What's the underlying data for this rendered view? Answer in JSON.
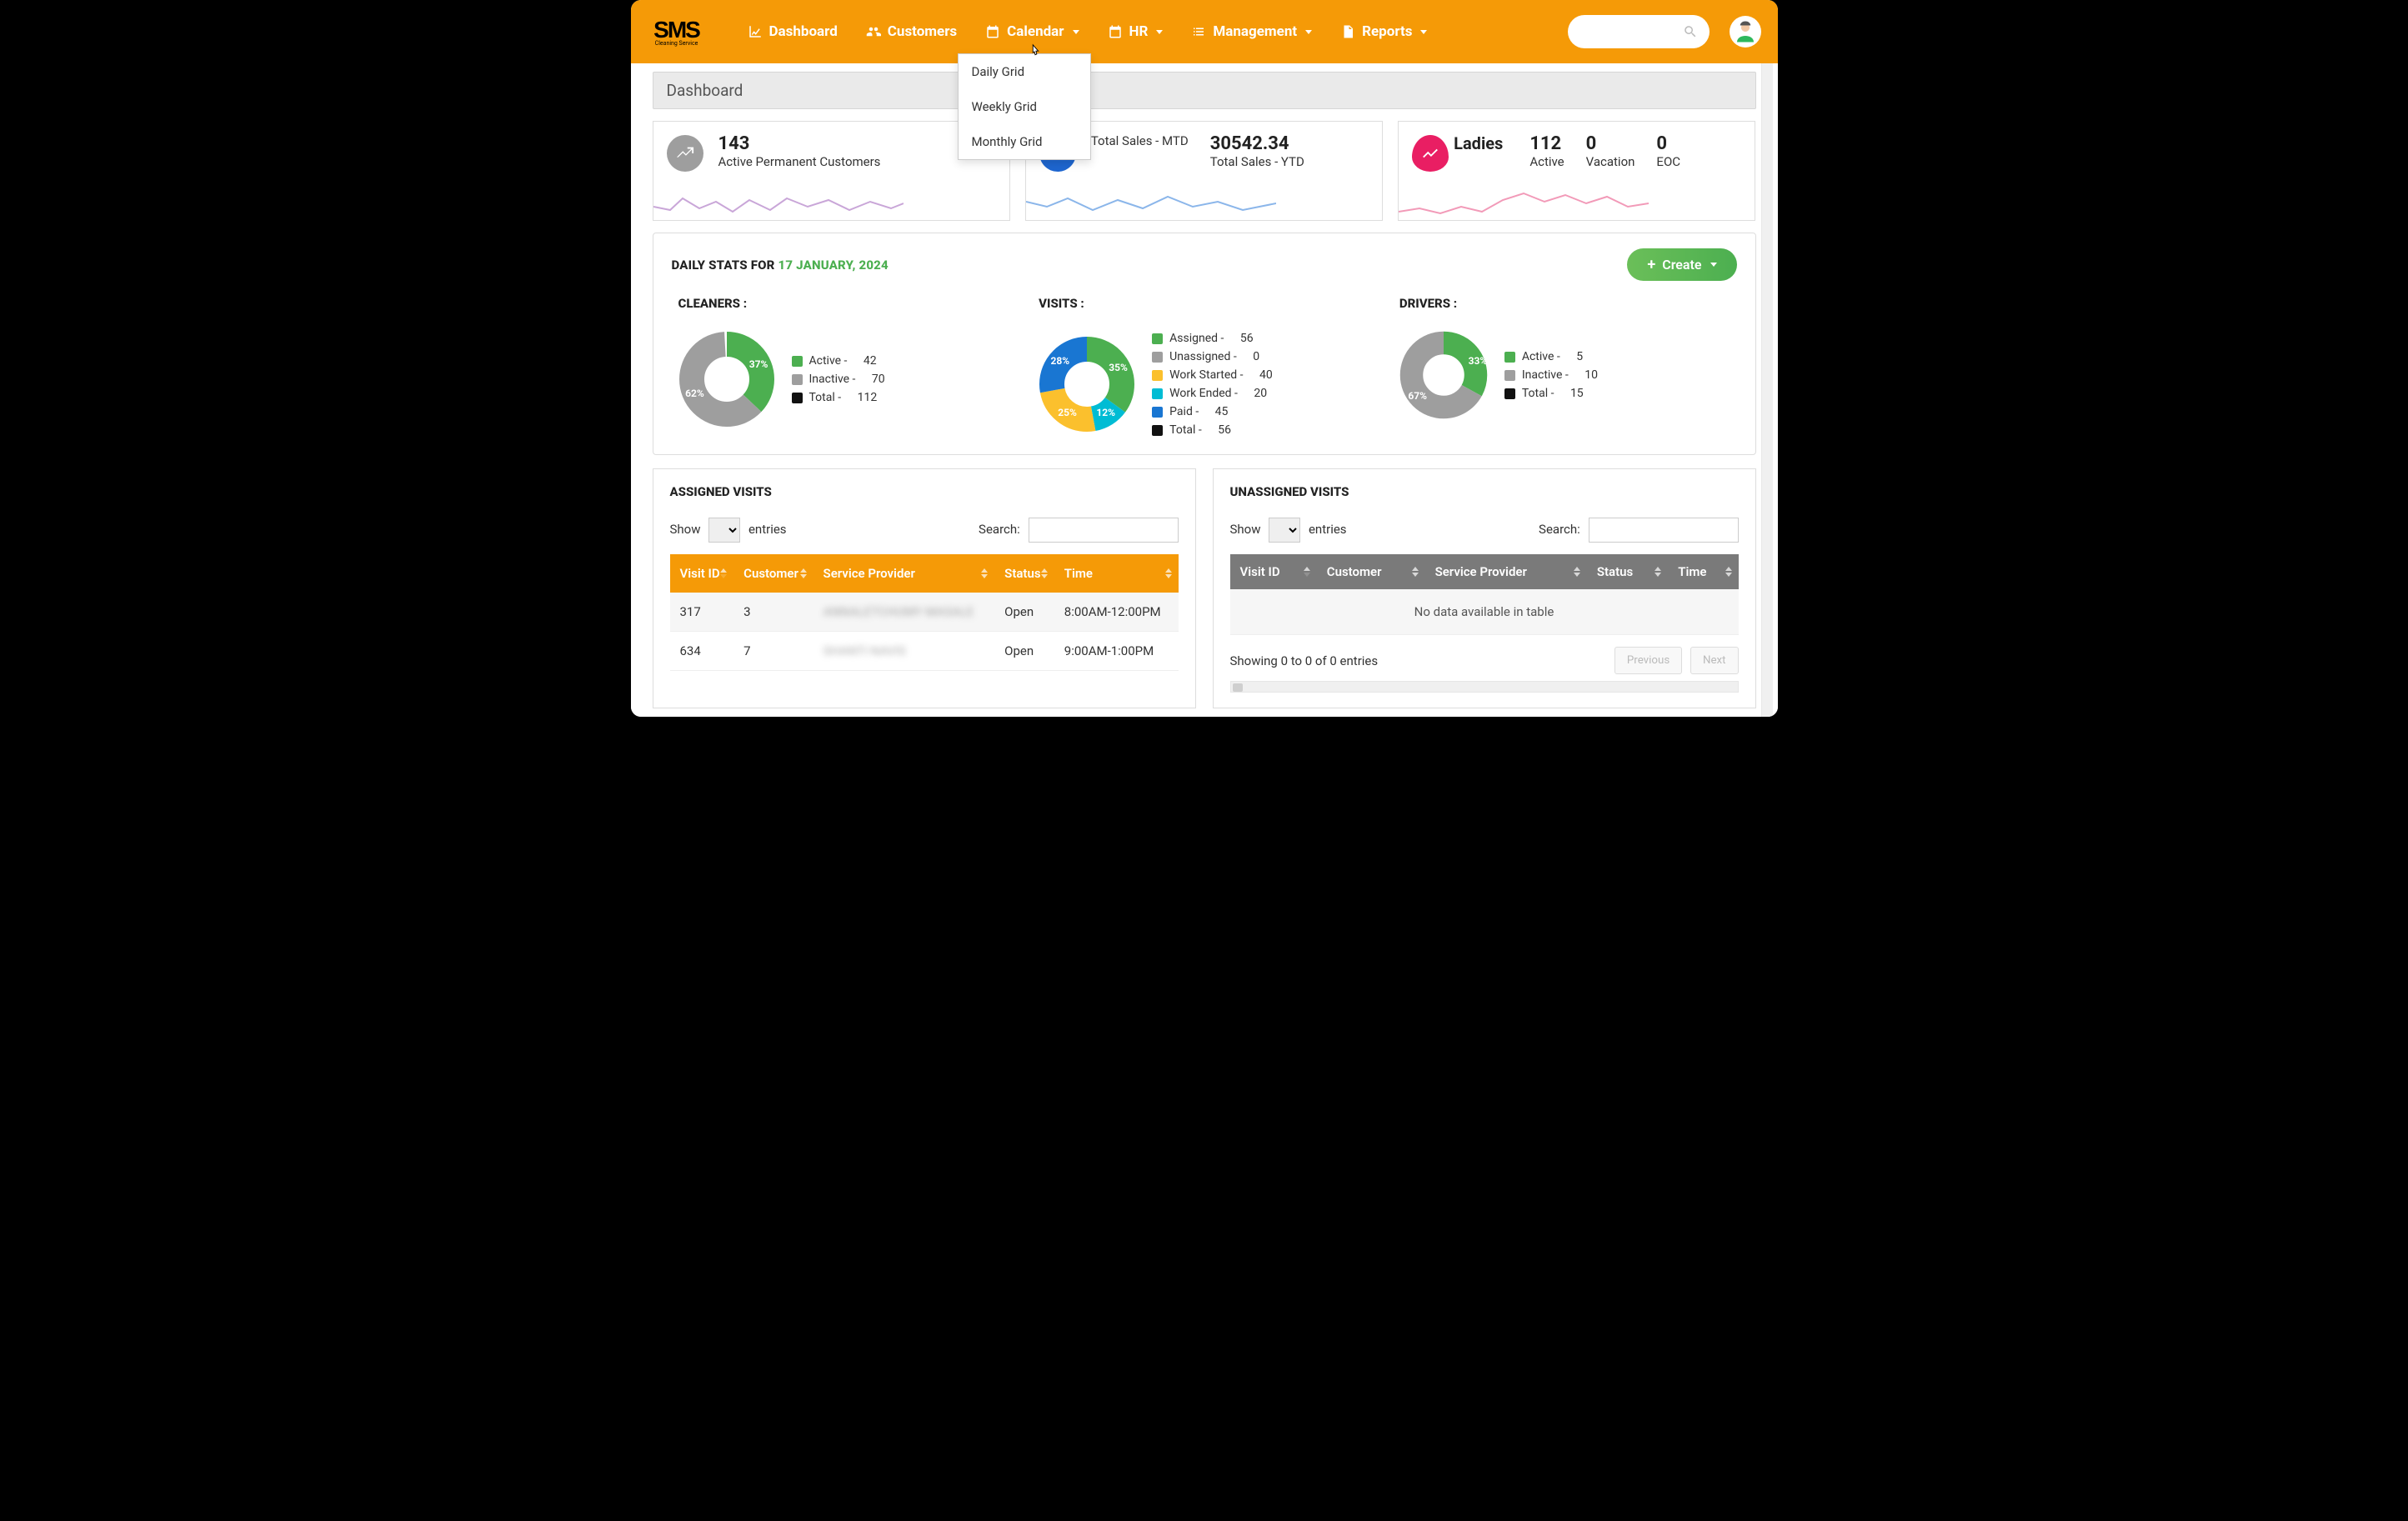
{
  "brand": {
    "name": "SMS",
    "sub": "Cleaning Service"
  },
  "nav": {
    "dashboard": "Dashboard",
    "customers": "Customers",
    "calendar": "Calendar",
    "hr": "HR",
    "management": "Management",
    "reports": "Reports"
  },
  "calendar_dropdown": [
    "Daily Grid",
    "Weekly Grid",
    "Monthly Grid"
  ],
  "page_title": "Dashboard",
  "cards": {
    "customers": {
      "value": "143",
      "label": "Active Permanent Customers",
      "color": "#9e9e9e"
    },
    "sales": {
      "mtd_value": "",
      "mtd_label": "Total Sales - MTD",
      "ytd_value": "30542.34",
      "ytd_label": "Total Sales - YTD",
      "color": "#1e66d0"
    },
    "ladies": {
      "title": "Ladies",
      "active_value": "112",
      "active_label": "Active",
      "vacation_value": "0",
      "vacation_label": "Vacation",
      "eoc_value": "0",
      "eoc_label": "EOC",
      "color": "#e91e63"
    }
  },
  "daily": {
    "title_prefix": "DAILY STATS FOR ",
    "date": "17 JANUARY, 2024",
    "create": "Create"
  },
  "cleaners": {
    "heading": "CLEANERS :",
    "legend": [
      {
        "label": "Active",
        "value": 42,
        "color": "#4CAF50"
      },
      {
        "label": "Inactive",
        "value": 70,
        "color": "#9e9e9e"
      },
      {
        "label": "Total",
        "value": 112,
        "color": "#111"
      }
    ],
    "slices": [
      {
        "pct": 37,
        "color": "#4CAF50"
      },
      {
        "pct": 62,
        "color": "#9e9e9e"
      }
    ]
  },
  "visits": {
    "heading": "VISITS :",
    "legend": [
      {
        "label": "Assigned",
        "value": 56,
        "color": "#4CAF50"
      },
      {
        "label": "Unassigned",
        "value": 0,
        "color": "#9e9e9e"
      },
      {
        "label": "Work Started",
        "value": 40,
        "color": "#fbc02d"
      },
      {
        "label": "Work Ended",
        "value": 20,
        "color": "#00bcd4"
      },
      {
        "label": "Paid",
        "value": 45,
        "color": "#1976d2"
      },
      {
        "label": "Total",
        "value": 56,
        "color": "#111"
      }
    ],
    "slices": [
      {
        "pct": 35,
        "color": "#4CAF50"
      },
      {
        "pct": 12,
        "color": "#00bcd4"
      },
      {
        "pct": 25,
        "color": "#fbc02d"
      },
      {
        "pct": 28,
        "color": "#1976d2"
      }
    ]
  },
  "drivers": {
    "heading": "DRIVERS :",
    "legend": [
      {
        "label": "Active",
        "value": 5,
        "color": "#4CAF50"
      },
      {
        "label": "Inactive",
        "value": 10,
        "color": "#9e9e9e"
      },
      {
        "label": "Total",
        "value": 15,
        "color": "#111"
      }
    ],
    "slices": [
      {
        "pct": 33,
        "color": "#4CAF50"
      },
      {
        "pct": 67,
        "color": "#9e9e9e"
      }
    ]
  },
  "assigned": {
    "heading": "ASSIGNED VISITS",
    "show": "Show",
    "entries": "entries",
    "search": "Search:",
    "cols": [
      "Visit ID",
      "Customer",
      "Service Provider",
      "Status",
      "Time"
    ],
    "rows": [
      {
        "id": "317",
        "customer": "3",
        "provider": "ANNALETCHUMY MASALE",
        "status": "Open",
        "time": "8:00AM-12:00PM"
      },
      {
        "id": "634",
        "customer": "7",
        "provider": "SHANTI NAVIS",
        "status": "Open",
        "time": "9:00AM-1:00PM"
      }
    ]
  },
  "unassigned": {
    "heading": "UNASSIGNED VISITS",
    "show": "Show",
    "entries": "entries",
    "search": "Search:",
    "cols": [
      "Visit ID",
      "Customer",
      "Service Provider",
      "Status",
      "Time"
    ],
    "empty": "No data available in table",
    "info": "Showing 0 to 0 of 0 entries",
    "prev": "Previous",
    "next": "Next"
  },
  "chart_data": [
    {
      "type": "pie",
      "title": "Cleaners",
      "series": [
        {
          "name": "Active",
          "value": 42
        },
        {
          "name": "Inactive",
          "value": 70
        }
      ],
      "total": 112
    },
    {
      "type": "pie",
      "title": "Visits",
      "series": [
        {
          "name": "Assigned",
          "value": 56
        },
        {
          "name": "Unassigned",
          "value": 0
        },
        {
          "name": "Work Started",
          "value": 40
        },
        {
          "name": "Work Ended",
          "value": 20
        },
        {
          "name": "Paid",
          "value": 45
        }
      ],
      "total": 56
    },
    {
      "type": "pie",
      "title": "Drivers",
      "series": [
        {
          "name": "Active",
          "value": 5
        },
        {
          "name": "Inactive",
          "value": 10
        }
      ],
      "total": 15
    }
  ]
}
